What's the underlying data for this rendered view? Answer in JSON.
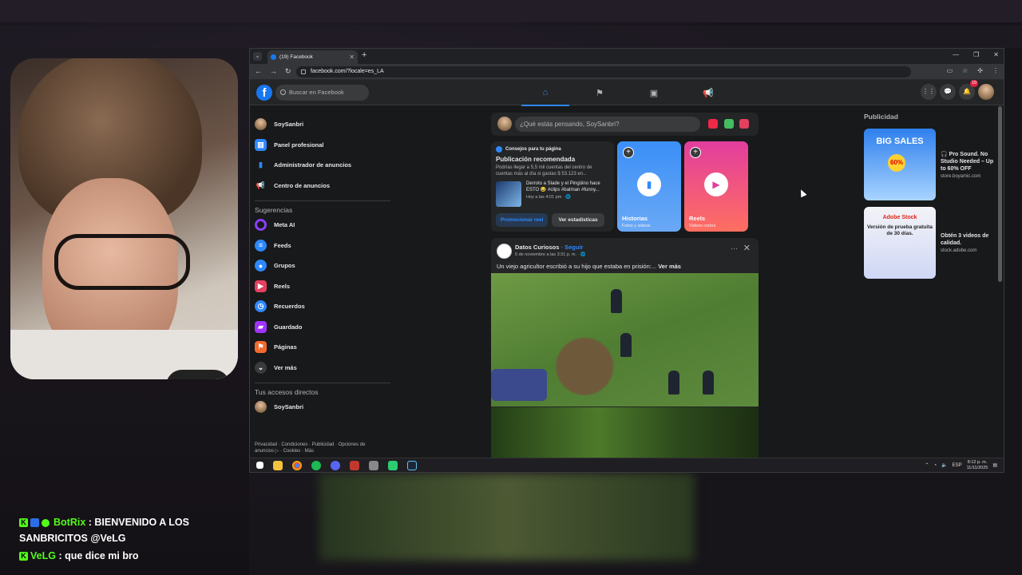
{
  "browser": {
    "tab_title": "(19) Facebook",
    "url": "facebook.com/?locale=es_LA"
  },
  "facebook": {
    "search_placeholder": "Buscar en Facebook",
    "notification_count": "19",
    "left_menu": [
      {
        "label": "SoySanbri",
        "icon": "avatar"
      },
      {
        "label": "Panel profesional",
        "icon": "dashboard-icon"
      },
      {
        "label": "Administrador de anuncios",
        "icon": "bar-chart-icon"
      },
      {
        "label": "Centro de anuncios",
        "icon": "megaphone-icon"
      }
    ],
    "suggestions_title": "Sugerencias",
    "suggestions": [
      {
        "label": "Meta AI",
        "icon": "meta-ai-icon"
      },
      {
        "label": "Feeds",
        "icon": "feeds-icon"
      },
      {
        "label": "Grupos",
        "icon": "groups-icon"
      },
      {
        "label": "Reels",
        "icon": "reels-icon"
      },
      {
        "label": "Recuerdos",
        "icon": "clock-icon"
      },
      {
        "label": "Guardado",
        "icon": "bookmark-icon"
      },
      {
        "label": "Páginas",
        "icon": "flag-icon"
      },
      {
        "label": "Ver más",
        "icon": "chevron-down-icon"
      }
    ],
    "shortcuts_title": "Tus accesos directos",
    "shortcut": "SoySanbri",
    "footer": "Privacidad · Condiciones · Publicidad · Opciones de anuncios ▷ · Cookies · Más",
    "composer_placeholder": "¿Qué estás pensando, SoySanbri?",
    "tips": {
      "label": "Consejos para tu página",
      "title": "Publicación recomendada",
      "text": "Podrías llegar a 5,5 mil cuentas del centro de cuentas más al día si gastas $ 53.123 en...",
      "post_text": "Derroto a Slade y el Pingüino hace ESTO 😂 #clips #batman #funny...",
      "post_time": "Hoy a las 4:01 pm · 🌐",
      "promote_button": "Promocionar reel",
      "stats_button": "Ver estadísticas"
    },
    "stories": [
      {
        "title": "Historias",
        "subtitle": "Fotos y videos"
      },
      {
        "title": "Reels",
        "subtitle": "Videos cortos"
      }
    ],
    "post": {
      "author": "Datos Curiosos",
      "follow": "· Seguir",
      "time": "5 de noviembre a las 3:31 p. m. · 🌐",
      "text": "Un viejo agricultor escribió a su hijo que estaba en prisión:...",
      "see_more": "Ver más"
    },
    "ads_title": "Publicidad",
    "ads": [
      {
        "image_text": "BIG SALES",
        "image_badge": "60%",
        "title": "🎧 Pro Sound. No Studio Needed – Up to 60% OFF",
        "domain": "store.boyamic.com"
      },
      {
        "image_text": "Adobe Stock",
        "image_sub": "Versión de prueba gratuita de 30 días.",
        "title": "Obtén 3 videos de calidad.",
        "domain": "stock.adobe.com"
      }
    ]
  },
  "taskbar": {
    "lang": "ESP",
    "time": "8:12 p. m.",
    "date": "11/11/2025"
  },
  "chat": [
    {
      "user": "BotRix",
      "message": ": BIENVENIDO A LOS SANBRICITOS @VeLG"
    },
    {
      "user": "VeLG",
      "message": ": que dice mi bro"
    }
  ]
}
